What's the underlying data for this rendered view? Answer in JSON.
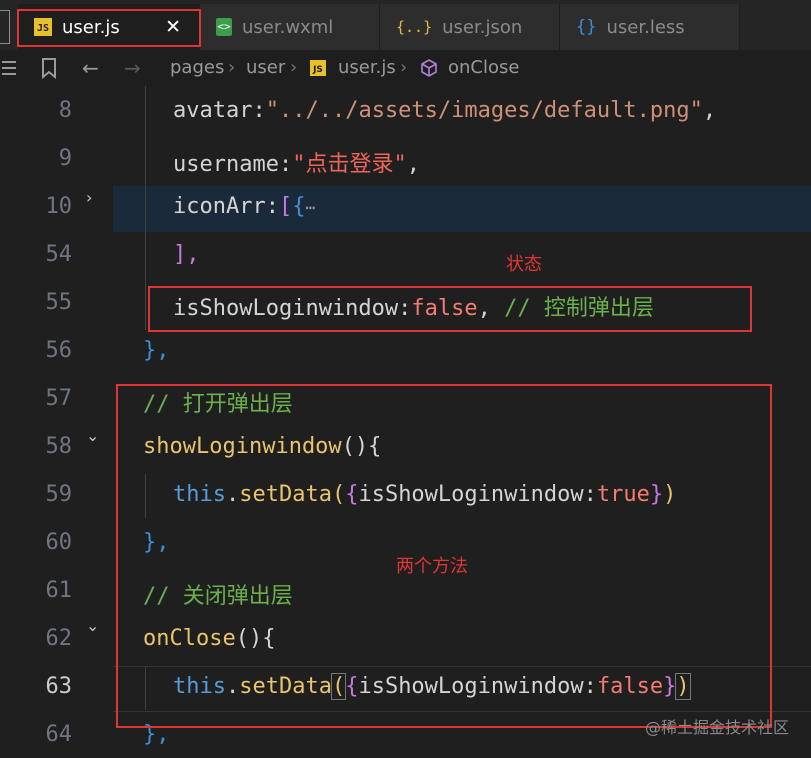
{
  "tabs": [
    {
      "label": "user.js",
      "icon": "JS",
      "active": true
    },
    {
      "label": "user.wxml",
      "icon": "wxml-icon"
    },
    {
      "label": "user.json",
      "icon": "{..}"
    },
    {
      "label": "user.less",
      "icon": "{}"
    }
  ],
  "tab_close": "✕",
  "breadcrumb": {
    "folder1": "pages",
    "folder2": "user",
    "file": "user.js",
    "symbol": "onClose"
  },
  "lines": [
    {
      "num": "8"
    },
    {
      "num": "9"
    },
    {
      "num": "10"
    },
    {
      "num": "54"
    },
    {
      "num": "55"
    },
    {
      "num": "56"
    },
    {
      "num": "57"
    },
    {
      "num": "58"
    },
    {
      "num": "59"
    },
    {
      "num": "60"
    },
    {
      "num": "61"
    },
    {
      "num": "62"
    },
    {
      "num": "63"
    },
    {
      "num": "64"
    }
  ],
  "code": {
    "l8_key": "avatar",
    "l8_colon": ":",
    "l8_str": "\"../../assets/images/default.png\"",
    "l8_comma": ",",
    "l9_key": "username",
    "l9_colon": ":",
    "l9_str": "\"点击登录\"",
    "l9_comma": ",",
    "l10_key": "iconArr",
    "l10_colon": ":",
    "l10_bracket": "[",
    "l10_brace": "{",
    "l10_ellipsis": "⋯",
    "l54_text": "],",
    "l55_key": "isShowLoginwindow",
    "l55_colon": ":",
    "l55_val": "false",
    "l55_comma": ",",
    "l55_comment": "// 控制弹出层",
    "l56_text": "},",
    "l57_comment": "// 打开弹出层",
    "l58_func": "showLoginwindow",
    "l58_rest": "(){",
    "l59_this": "this",
    "l59_dot": ".",
    "l59_method": "setData",
    "l59_paren_open": "(",
    "l59_brace_open": "{",
    "l59_key": "isShowLoginwindow",
    "l59_colon": ":",
    "l59_val": "true",
    "l59_brace_close": "}",
    "l59_paren_close": ")",
    "l60_text": "},",
    "l61_comment": "// 关闭弹出层",
    "l62_func": "onClose",
    "l62_rest": "(){",
    "l63_this": "this",
    "l63_dot": ".",
    "l63_method": "setData",
    "l63_paren_open": "(",
    "l63_brace_open": "{",
    "l63_key": "isShowLoginwindow",
    "l63_colon": ":",
    "l63_val": "false",
    "l63_brace_close": "}",
    "l63_paren_close": ")",
    "l64_text": "},"
  },
  "annotations": {
    "state": "状态",
    "methods": "两个方法"
  },
  "watermark": "@稀土掘金技术社区",
  "colors": {
    "annotation": "#e03535",
    "comment": "#6ab04c",
    "string": "#ce9178",
    "function": "#e9c46a",
    "keyword_this": "#569cd6"
  }
}
